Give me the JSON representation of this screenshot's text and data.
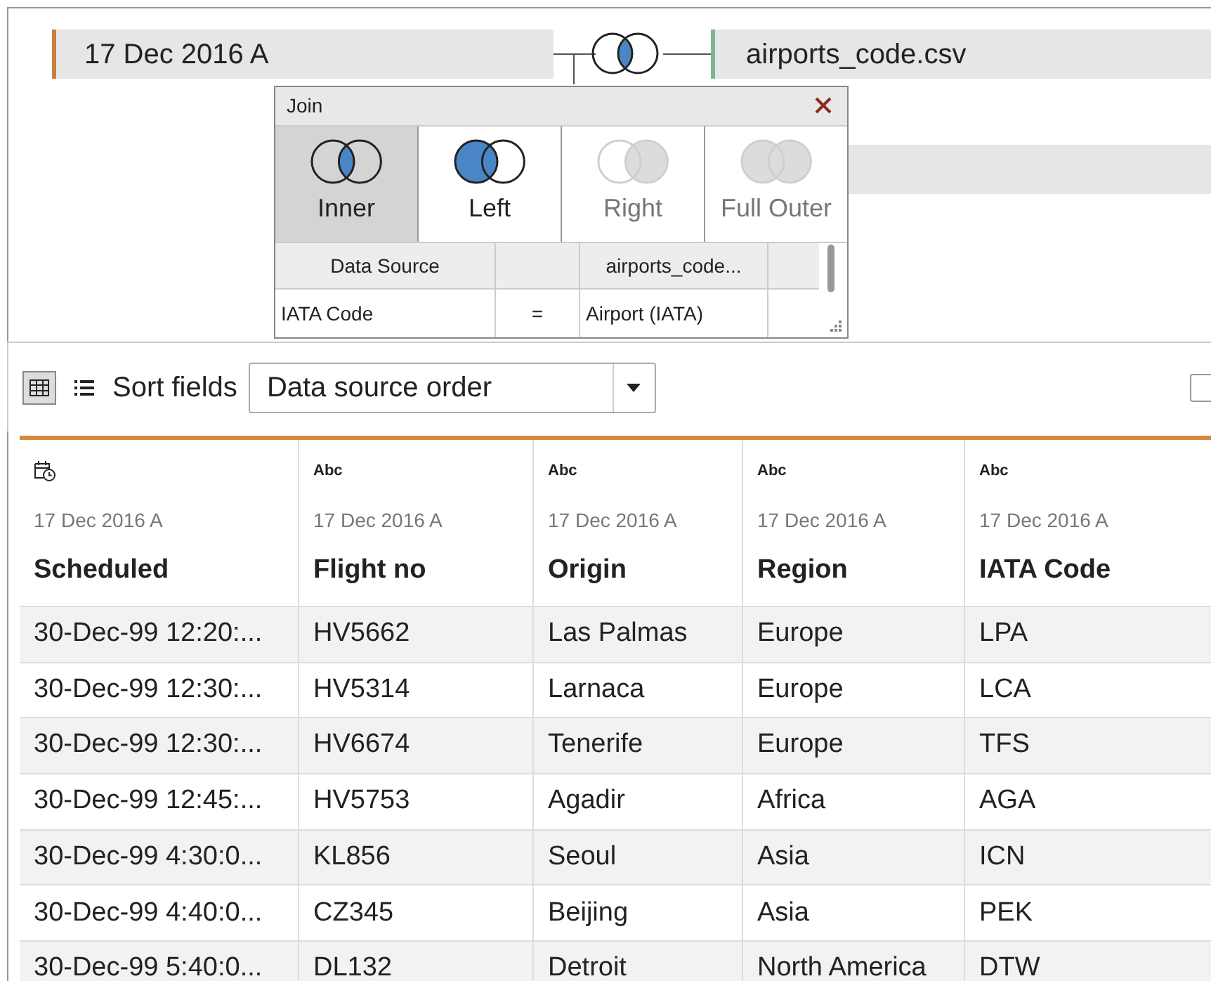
{
  "join_canvas": {
    "left_table": {
      "name": "17 Dec 2016 A"
    },
    "join_icon": {
      "kind": "inner"
    },
    "right_table": {
      "name": "airports_code.csv"
    }
  },
  "join_dialog": {
    "title": "Join",
    "join_types": [
      {
        "label": "Inner",
        "kind": "inner",
        "selected": true,
        "disabled": false
      },
      {
        "label": "Left",
        "kind": "left",
        "selected": false,
        "disabled": false
      },
      {
        "label": "Right",
        "kind": "right",
        "selected": false,
        "disabled": true
      },
      {
        "label": "Full Outer",
        "kind": "full",
        "selected": false,
        "disabled": true
      }
    ],
    "clause_grid": {
      "left_header": "Data Source",
      "right_header": "airports_code...",
      "clauses": [
        {
          "left": "IATA Code",
          "operator": "=",
          "right": "Airport (IATA)"
        }
      ]
    }
  },
  "toolbar": {
    "view_buttons": [
      {
        "kind": "grid",
        "selected": true
      },
      {
        "kind": "list",
        "selected": false
      }
    ],
    "sort_label": "Sort fields",
    "sort_dropdown": {
      "value": "Data source order"
    },
    "checkbox": {
      "checked": false
    }
  },
  "table": {
    "columns": [
      {
        "kind": "datetime",
        "source": "17 Dec 2016 A",
        "name": "Scheduled"
      },
      {
        "kind": "string",
        "type_label": "Abc",
        "source": "17 Dec 2016 A",
        "name": "Flight no"
      },
      {
        "kind": "string",
        "type_label": "Abc",
        "source": "17 Dec 2016 A",
        "name": "Origin"
      },
      {
        "kind": "string",
        "type_label": "Abc",
        "source": "17 Dec 2016 A",
        "name": "Region"
      },
      {
        "kind": "string",
        "type_label": "Abc",
        "source": "17 Dec 2016 A",
        "name": "IATA Code"
      }
    ],
    "rows": [
      [
        "30-Dec-99 12:20:...",
        "HV5662",
        "Las Palmas",
        "Europe",
        "LPA"
      ],
      [
        "30-Dec-99 12:30:...",
        "HV5314",
        "Larnaca",
        "Europe",
        "LCA"
      ],
      [
        "30-Dec-99 12:30:...",
        "HV6674",
        "Tenerife",
        "Europe",
        "TFS"
      ],
      [
        "30-Dec-99 12:45:...",
        "HV5753",
        "Agadir",
        "Africa",
        "AGA"
      ],
      [
        "30-Dec-99 4:30:0...",
        "KL856",
        "Seoul",
        "Asia",
        "ICN"
      ],
      [
        "30-Dec-99 4:40:0...",
        "CZ345",
        "Beijing",
        "Asia",
        "PEK"
      ],
      [
        "30-Dec-99 5:40:0...",
        "DL132",
        "Detroit",
        "North America",
        "DTW"
      ]
    ]
  }
}
